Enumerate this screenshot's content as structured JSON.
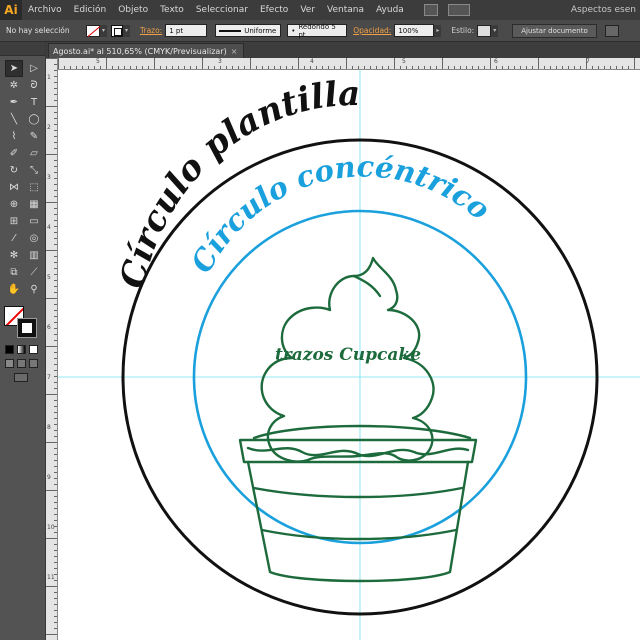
{
  "app": {
    "logo": "Ai",
    "workspace": "Aspectos esen"
  },
  "menu": [
    "Archivo",
    "Edición",
    "Objeto",
    "Texto",
    "Seleccionar",
    "Efecto",
    "Ver",
    "Ventana",
    "Ayuda"
  ],
  "control_bar": {
    "selection_status": "No hay selección",
    "stroke_label": "Trazo:",
    "stroke_weight": "1 pt",
    "profile": "Uniforme",
    "brush": "Redondo 5 pt.",
    "opacity_label": "Opacidad:",
    "opacity_value": "100%",
    "style_label": "Estilo:",
    "adjust_button": "Ajustar documento"
  },
  "document_tab": {
    "title": "Agosto.ai* al 510,65% (CMYK/Previsualizar)",
    "close": "×"
  },
  "rulers": {
    "h_labels": [
      "5",
      "3",
      "4",
      "5",
      "6",
      "7"
    ],
    "v_labels": [
      "1",
      "2",
      "3",
      "4",
      "5",
      "6",
      "7",
      "8",
      "9",
      "10",
      "11"
    ]
  },
  "artwork": {
    "outer_text": "Círculo plantilla",
    "inner_text": "Círculo concéntrico",
    "cupcake_text": "trazos Cupcake",
    "colors": {
      "outer": "#111111",
      "inner": "#1aa0dc",
      "cupcake": "#1d6b3c",
      "guides": "#6fe0f0"
    }
  },
  "tools": [
    "selection-tool",
    "direct-selection-tool",
    "magic-wand-tool",
    "lasso-tool",
    "pen-tool",
    "type-tool",
    "line-tool",
    "ellipse-tool",
    "paintbrush-tool",
    "pencil-tool",
    "blob-brush-tool",
    "eraser-tool",
    "rotate-tool",
    "scale-tool",
    "width-tool",
    "free-transform-tool",
    "shape-builder-tool",
    "perspective-grid-tool",
    "mesh-tool",
    "gradient-tool",
    "eyedropper-tool",
    "blend-tool",
    "symbol-sprayer-tool",
    "column-graph-tool",
    "artboard-tool",
    "slice-tool",
    "hand-tool",
    "zoom-tool"
  ]
}
